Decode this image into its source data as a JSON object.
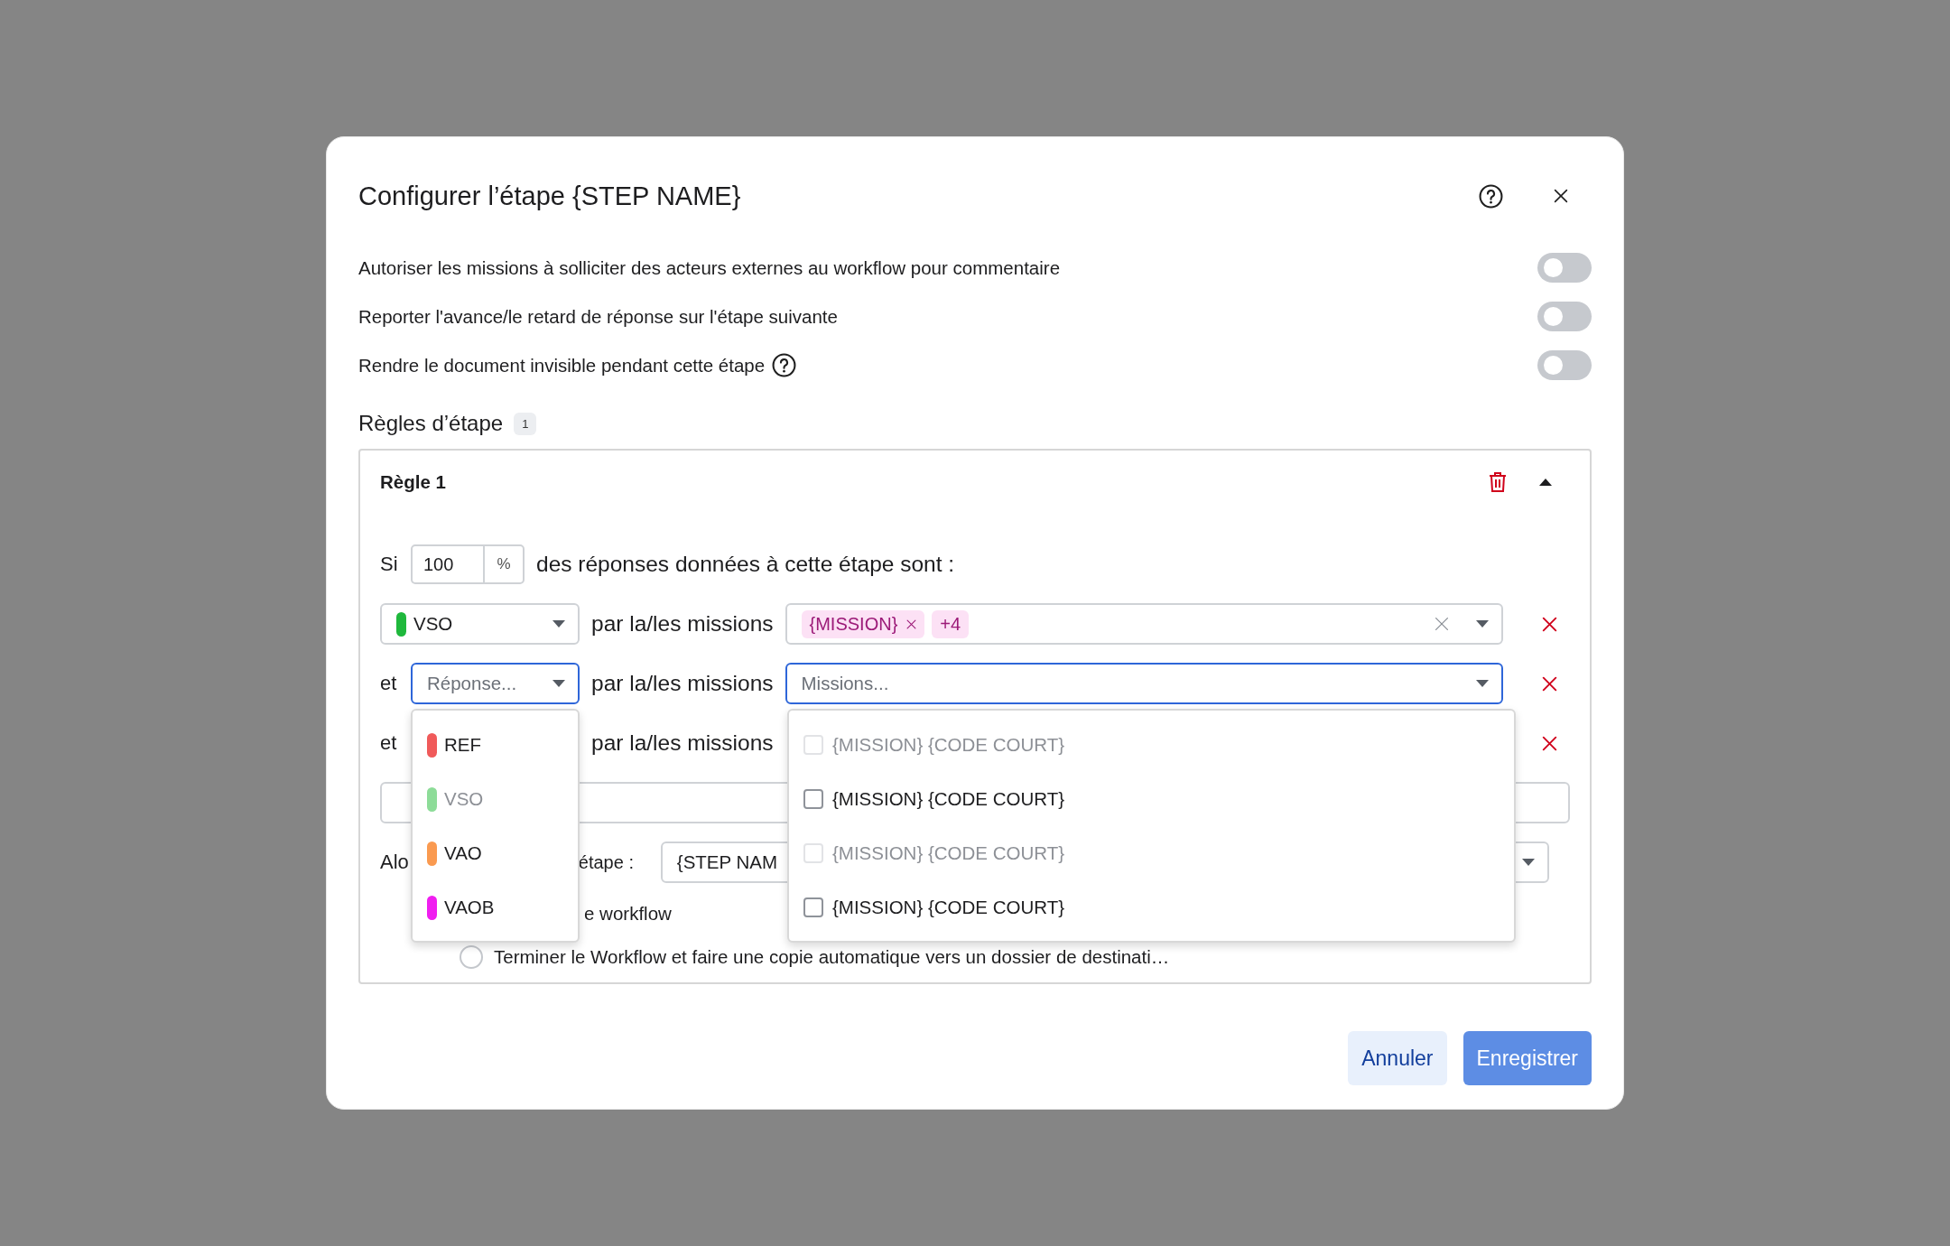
{
  "dialog": {
    "title": "Configurer l’étape {STEP NAME}"
  },
  "options": [
    {
      "label": "Autoriser les missions à solliciter des acteurs externes au workflow pour commentaire",
      "on": false
    },
    {
      "label": "Reporter l'avance/le retard de réponse sur l'étape suivante",
      "on": false
    },
    {
      "label": "Rendre le document invisible pendant cette étape",
      "on": false,
      "help": true
    }
  ],
  "rules_section": {
    "title": "Règles d’étape",
    "count": "1"
  },
  "rule": {
    "title": "Règle 1",
    "expanded": true,
    "condition": {
      "prefix": "Si",
      "value": "100",
      "unit": "%",
      "suffix": "des réponses données à cette étape sont :"
    },
    "lines": [
      {
        "response": {
          "label": "VSO",
          "color": "#1fb83c"
        },
        "missions_label": "par la/les missions",
        "missions": {
          "chips": [
            {
              "label": "{MISSION}",
              "removable": true
            },
            {
              "label": "+4"
            }
          ]
        },
        "focused": false
      },
      {
        "connector": "et",
        "placeholder": "Réponse...",
        "missions_label": "par la/les missions",
        "missions": {
          "placeholder": "Missions..."
        },
        "focused": true
      },
      {
        "connector": "et",
        "missions_label": "par la/les missions"
      }
    ],
    "then": {
      "label": "Alo",
      "step_label": "étape :",
      "step_value": "{STEP NAM"
    },
    "radios": [
      {
        "label": "e workflow"
      },
      {
        "label": "Terminer le Workflow et faire une copie automatique vers un dossier de destinati…",
        "selected": false
      }
    ]
  },
  "response_menu": [
    {
      "label": "REF",
      "color": "#f05a5a",
      "disabled": false
    },
    {
      "label": "VSO",
      "color": "#8ddc98",
      "disabled": true
    },
    {
      "label": "VAO",
      "color": "#fa9a50",
      "disabled": false
    },
    {
      "label": "VAOB",
      "color": "#f01ef0",
      "disabled": false
    }
  ],
  "missions_menu": [
    {
      "label": "{MISSION} {CODE COURT}",
      "checked": false,
      "disabled": true
    },
    {
      "label": "{MISSION} {CODE COURT}",
      "checked": false,
      "disabled": false
    },
    {
      "label": "{MISSION} {CODE COURT}",
      "checked": false,
      "disabled": true
    },
    {
      "label": "{MISSION} {CODE COURT}",
      "checked": false,
      "disabled": false
    }
  ],
  "buttons": [
    {
      "label": "Annuler",
      "kind": "secondary",
      "disabled": false
    },
    {
      "label": "Enregistrer",
      "kind": "primary",
      "disabled": true
    }
  ]
}
